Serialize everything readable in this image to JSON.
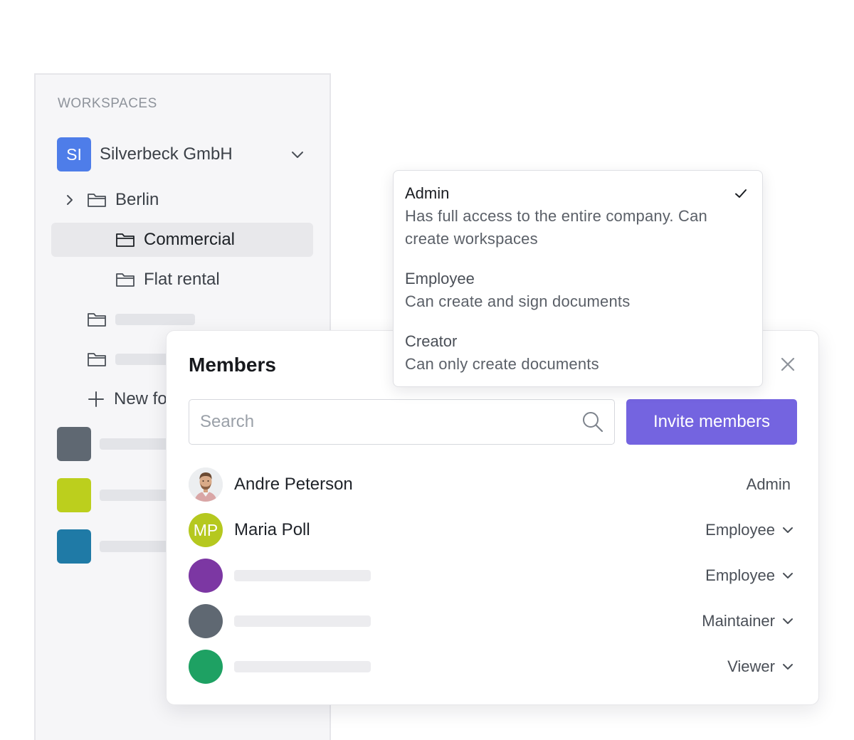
{
  "sidebar": {
    "heading": "WORKSPACES",
    "company": {
      "initials": "SI",
      "name": "Silverbeck GmbH",
      "badge_color": "#4e7de9"
    },
    "tree": [
      {
        "label": "Berlin",
        "expandable": true
      },
      {
        "label": "Commercial",
        "selected": true
      },
      {
        "label": "Flat rental"
      }
    ],
    "new_folder_label": "New fo",
    "workspace_colors": [
      "#5f6872",
      "#bccf1d",
      "#1f7aa6"
    ]
  },
  "members_panel": {
    "title": "Members",
    "search": {
      "placeholder": "Search",
      "value": ""
    },
    "invite_label": "Invite members",
    "accent_color": "#7464e0",
    "members": [
      {
        "name": "Andre Peterson",
        "role": "Admin",
        "avatar": "photo",
        "editable": false
      },
      {
        "name": "Maria Poll",
        "initials": "MP",
        "avatar_color": "#b5c81f",
        "role": "Employee",
        "editable": true
      },
      {
        "name": "",
        "avatar_color": "#7c37a3",
        "role": "Employee",
        "editable": true
      },
      {
        "name": "",
        "avatar_color": "#5f6872",
        "role": "Maintainer",
        "editable": true
      },
      {
        "name": "",
        "avatar_color": "#1ea163",
        "role": "Viewer",
        "editable": true
      }
    ]
  },
  "role_dropdown": {
    "options": [
      {
        "title": "Admin",
        "description_line1": "Has full access to the entire company. Can",
        "description_line2": "create workspaces",
        "selected": true
      },
      {
        "title": "Employee",
        "description": "Can create and sign documents"
      },
      {
        "title": "Creator",
        "description": "Can only create documents"
      }
    ]
  }
}
